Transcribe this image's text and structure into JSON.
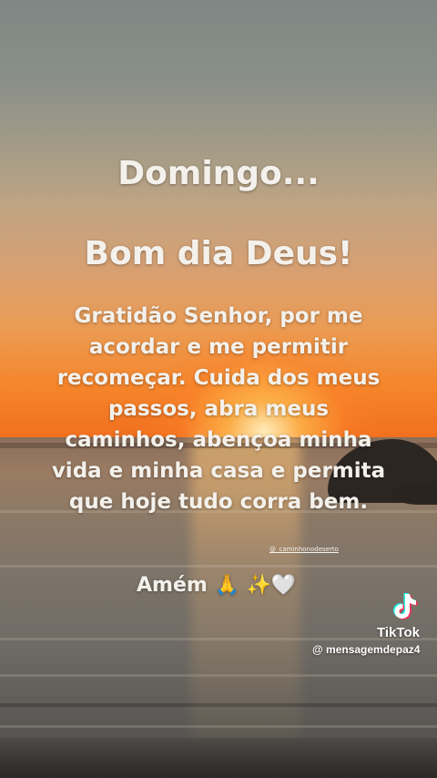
{
  "post": {
    "day": "Domingo...",
    "greeting": "Bom dia Deus!",
    "prayer": "Gratidão Senhor, por me acordar e me permitir recomeçar. Cuida dos meus passos, abra meus caminhos, abençoa minha vida e minha casa e permita que hoje tudo corra bem.",
    "credit": "@_caminhonodeserto",
    "amen": "Amém 🙏 ✨🤍"
  },
  "watermark": {
    "brand": "TikTok",
    "handle": "@ mensagemdepaz4",
    "icon": "tiktok-logo-icon"
  },
  "colors": {
    "text": "#f4f1ec",
    "sunset_orange": "#f16c1c",
    "sky_top": "#7f8784"
  }
}
